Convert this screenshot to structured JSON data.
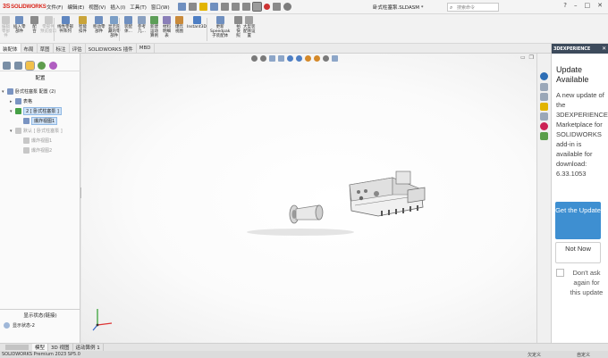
{
  "app": {
    "logo_ds": "3S",
    "logo_text": "SOLIDWORKS",
    "document_name": "卧式柱塞泵.SLDASM *"
  },
  "menu": [
    "文件(F)",
    "编辑(E)",
    "视图(V)",
    "插入(I)",
    "工具(T)",
    "窗口(W)"
  ],
  "search": {
    "placeholder": "搜索命令"
  },
  "window_controls": {
    "help": "?",
    "minimize": "–",
    "restore": "□",
    "close": "✕"
  },
  "ribbon": {
    "tools": [
      {
        "label": "编辑\n零部\n件",
        "dim": true
      },
      {
        "label": "插入零\n部件",
        "dim": false
      },
      {
        "label": "配\n合",
        "dim": false
      },
      {
        "label": "零部件\n预览窗口",
        "dim": true
      },
      {
        "label": "线性零部\n件阵列",
        "dim": false
      },
      {
        "label": "智能\n扣件",
        "dim": false
      },
      {
        "label": "移动零\n部件",
        "dim": false
      },
      {
        "label": "显示隐\n藏的零\n部件",
        "dim": false
      },
      {
        "label": "装配\n体...",
        "dim": false
      },
      {
        "label": "参考\n几...",
        "dim": false
      },
      {
        "label": "新建\n运动\n算例",
        "dim": false
      },
      {
        "label": "材料\n明细\n表",
        "dim": false
      },
      {
        "label": "爆炸\n视图",
        "dim": false
      },
      {
        "label": "Instant3D",
        "dim": false
      },
      {
        "label": "更新\nSpeedpak\n子装配体",
        "dim": false
      },
      {
        "label": "拍\n快\n照",
        "dim": false
      },
      {
        "label": "大型装\n配体设\n置",
        "dim": false
      }
    ]
  },
  "command_tabs": [
    "装配体",
    "布局",
    "草图",
    "标注",
    "评估",
    "SOLIDWORKS 插件",
    "MBD"
  ],
  "command_tab_active": 0,
  "left_panel": {
    "title": "配置",
    "tree": [
      {
        "label": "卧式柱塞泵 配置 (2)",
        "indent": 0,
        "twisty": "▾",
        "style": "normal"
      },
      {
        "label": "表格",
        "indent": 1,
        "twisty": "▸",
        "style": "normal"
      },
      {
        "label": "2 [ 卧式柱塞泵 ]",
        "indent": 1,
        "twisty": "▾",
        "style": "selected"
      },
      {
        "label": "爆炸视图1",
        "indent": 2,
        "twisty": "",
        "style": "selected"
      },
      {
        "label": "默认 [ 卧式柱塞泵 ]",
        "indent": 1,
        "twisty": "▾",
        "style": "dim"
      },
      {
        "label": "爆炸视图1",
        "indent": 2,
        "twisty": "",
        "style": "dim"
      },
      {
        "label": "爆炸视图2",
        "indent": 2,
        "twisty": "",
        "style": "dim"
      }
    ],
    "display_state_header": "显示状态(链接)",
    "display_state_item": "显示状态-2"
  },
  "update_panel": {
    "header": "3DEXPERIENCE",
    "title": "Update Available",
    "message": "A new update of the 3DEXPERIENCE Marketplace for SOLIDWORKS add-in is available for download: 6.33.1053",
    "get_button": "Get the Update",
    "later_button": "Not Now",
    "dont_ask": "Don't ask again for this update"
  },
  "bottom_tabs": [
    "模型",
    "3D 视图",
    "运动算例 1"
  ],
  "bottom_tab_active": 0,
  "status": {
    "product": "SOLIDWORKS Premium 2023 SP5.0",
    "edit_state": "欠定义",
    "units": "自定义"
  },
  "colors": {
    "accent": "#3e8fd1",
    "header_dark": "#3d4b5c",
    "logo_red": "#d9261c"
  }
}
